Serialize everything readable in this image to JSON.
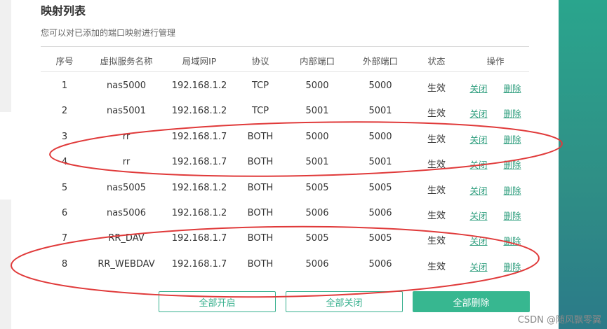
{
  "header": {
    "title": "映射列表",
    "subtitle": "您可以对已添加的端口映射进行管理"
  },
  "table": {
    "columns": [
      "序号",
      "虚拟服务名称",
      "局域网IP",
      "协议",
      "内部端口",
      "外部端口",
      "状态",
      "操作"
    ],
    "rows": [
      {
        "idx": "1",
        "name": "nas5000",
        "ip": "192.168.1.2",
        "protocol": "TCP",
        "internal": "5000",
        "external": "5000",
        "status": "生效",
        "action_close": "关闭",
        "action_delete": "删除"
      },
      {
        "idx": "2",
        "name": "nas5001",
        "ip": "192.168.1.2",
        "protocol": "TCP",
        "internal": "5001",
        "external": "5001",
        "status": "生效",
        "action_close": "关闭",
        "action_delete": "删除"
      },
      {
        "idx": "3",
        "name": "rr",
        "ip": "192.168.1.7",
        "protocol": "BOTH",
        "internal": "5000",
        "external": "5000",
        "status": "生效",
        "action_close": "关闭",
        "action_delete": "删除"
      },
      {
        "idx": "4",
        "name": "rr",
        "ip": "192.168.1.7",
        "protocol": "BOTH",
        "internal": "5001",
        "external": "5001",
        "status": "生效",
        "action_close": "关闭",
        "action_delete": "删除"
      },
      {
        "idx": "5",
        "name": "nas5005",
        "ip": "192.168.1.2",
        "protocol": "BOTH",
        "internal": "5005",
        "external": "5005",
        "status": "生效",
        "action_close": "关闭",
        "action_delete": "删除"
      },
      {
        "idx": "6",
        "name": "nas5006",
        "ip": "192.168.1.2",
        "protocol": "BOTH",
        "internal": "5006",
        "external": "5006",
        "status": "生效",
        "action_close": "关闭",
        "action_delete": "删除"
      },
      {
        "idx": "7",
        "name": "RR_DAV",
        "ip": "192.168.1.7",
        "protocol": "BOTH",
        "internal": "5005",
        "external": "5005",
        "status": "生效",
        "action_close": "关闭",
        "action_delete": "删除"
      },
      {
        "idx": "8",
        "name": "RR_WEBDAV",
        "ip": "192.168.1.7",
        "protocol": "BOTH",
        "internal": "5006",
        "external": "5006",
        "status": "生效",
        "action_close": "关闭",
        "action_delete": "删除"
      }
    ]
  },
  "buttons": {
    "enable_all": "全部开启",
    "close_all": "全部关闭",
    "delete_all": "全部删除"
  },
  "watermark": "CSDN @随风飘零翼",
  "colors": {
    "accent": "#37b790",
    "link": "#2f9e7e",
    "annotation": "#e03a3a",
    "side_panel": "#2a9a8a"
  }
}
